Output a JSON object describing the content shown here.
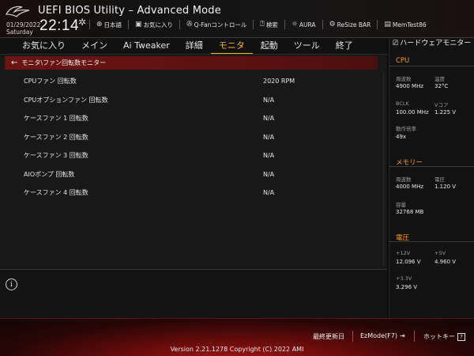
{
  "header": {
    "title": "UEFI BIOS Utility – Advanced Mode",
    "date": "01/29/2022",
    "weekday": "Saturday",
    "time": "22:14",
    "tools": [
      {
        "icon": "globe-icon",
        "label": "日本語"
      },
      {
        "icon": "star-icon",
        "label": "お気に入り"
      },
      {
        "icon": "fan-icon",
        "label": "Q-Fanコントロール"
      },
      {
        "icon": "help-icon",
        "label": "検索"
      },
      {
        "icon": "aura-icon",
        "label": "AURA"
      },
      {
        "icon": "resize-bar-icon",
        "label": "ReSize BAR"
      },
      {
        "icon": "memtest-icon",
        "label": "MemTest86"
      }
    ]
  },
  "menu": [
    {
      "label": "お気に入り",
      "active": false
    },
    {
      "label": "メイン",
      "active": false
    },
    {
      "label": "Ai Tweaker",
      "active": false
    },
    {
      "label": "詳細",
      "active": false
    },
    {
      "label": "モニタ",
      "active": true
    },
    {
      "label": "起動",
      "active": false
    },
    {
      "label": "ツール",
      "active": false
    },
    {
      "label": "終了",
      "active": false
    }
  ],
  "breadcrumb": "モニタ\\ファン回転数モニター",
  "rows": [
    {
      "label": "CPUファン 回転数",
      "value": "2020 RPM"
    },
    {
      "label": "CPUオプションファン 回転数",
      "value": "N/A"
    },
    {
      "label": "ケースファン 1 回転数",
      "value": "N/A"
    },
    {
      "label": "ケースファン 2 回転数",
      "value": "N/A"
    },
    {
      "label": "ケースファン 3 回転数",
      "value": "N/A"
    },
    {
      "label": "AIOポンプ 回転数",
      "value": "N/A"
    },
    {
      "label": "ケースファン 4 回転数",
      "value": "N/A"
    }
  ],
  "hwmon": {
    "title": "ハードウェアモニター",
    "cpu": {
      "section": "CPU",
      "freq_label": "周波数",
      "freq_value": "4900 MHz",
      "temp_label": "温度",
      "temp_value": "32°C",
      "bclk_label": "BCLK",
      "bclk_value": "100.00 MHz",
      "vcore_label": "Vコア",
      "vcore_value": "1.225 V",
      "ratio_label": "動作倍率",
      "ratio_value": "49x"
    },
    "memory": {
      "section": "メモリー",
      "freq_label": "周波数",
      "freq_value": "4000 MHz",
      "volt_label": "電圧",
      "volt_value": "1.120 V",
      "cap_label": "容量",
      "cap_value": "32768 MB"
    },
    "voltage": {
      "section": "電圧",
      "v12_label": "+12V",
      "v12_value": "12.096 V",
      "v5_label": "+5V",
      "v5_value": "4.960 V",
      "v33_label": "+3.3V",
      "v33_value": "3.296 V"
    }
  },
  "footer": {
    "last_modified": "最終更新日",
    "ezmode": "EzMode(F7)",
    "hotkeys": "ホットキー",
    "hotkey_key": "?",
    "copyright": "Version 2.21.1278 Copyright (C) 2022 AMI"
  },
  "colors": {
    "accent": "#ffb020",
    "section": "#ff9a1a",
    "breadcrumb_bg": "#6b1414"
  }
}
